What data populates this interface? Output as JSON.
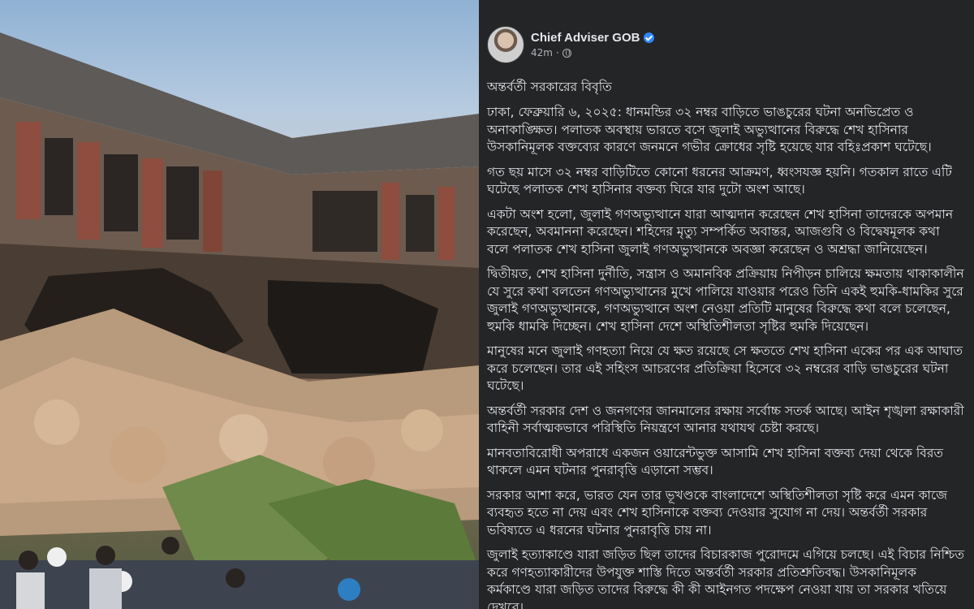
{
  "post": {
    "author": "Chief Adviser GOB",
    "time": "42m",
    "separator": "·",
    "title": "অন্তর্বর্তী সরকারের বিবৃতি",
    "paragraphs": [
      "ঢাকা, ফেব্রুয়ারি ৬, ২০২৫: ধানমন্ডির ৩২ নম্বর বাড়িতে ভাঙচুরের ঘটনা অনভিপ্রেত ও অনাকাঙ্ক্ষিত। পলাতক অবস্থায় ভারতে বসে জুলাই অভ্যুত্থানের বিরুদ্ধে শেখ হাসিনার উসকানিমূলক বক্তব্যের কারণে জনমনে গভীর ক্রোধের সৃষ্টি হয়েছে যার বহিঃপ্রকাশ ঘটেছে।",
      "গত ছয় মাসে ৩২ নম্বর বাড়িটিতে কোনো ধরনের আক্রমণ, ধ্বংসযজ্ঞ হয়নি। গতকাল রাতে এটি ঘটেছে পলাতক শেখ হাসিনার বক্তব্য ঘিরে যার দুটো অংশ আছে।",
      "একটা অংশ হলো, জুলাই গণঅভ্যুত্থানে যারা আত্মদান করেছেন শেখ হাসিনা তাদেরকে অপমান করেছেন, অবমাননা করেছেন। শহিদের মৃত্যু সম্পর্কিত অবান্তর, আজগুবি ও বিদ্বেষমূলক কথা বলে পলাতক শেখ হাসিনা জুলাই গণঅভ্যুত্থানকে অবজ্ঞা করেছেন ও অশ্রদ্ধা জানিয়েছেন।",
      "দ্বিতীয়ত, শেখ হাসিনা দুর্নীতি, সন্ত্রাস ও অমানবিক প্রক্রিয়ায় নিপীড়ন চালিয়ে ক্ষমতায় থাকাকালীন যে সুরে কথা বলতেন গণঅভ্যুত্থানের মুখে পালিয়ে যাওয়ার পরেও তিনি একই হুমকি-ধামকির সুরে জুলাই গণঅভ্যুত্থানকে, গণঅভ্যুত্থানে অংশ নেওয়া প্রতিটি মানুষের বিরুদ্ধে কথা বলে চলেছেন, হুমকি ধামকি দিচ্ছেন। শেখ হাসিনা দেশে অস্থিতিশীলতা সৃষ্টির হুমকি দিয়েছেন।",
      "মানুষের মনে জুলাই গণহত্যা নিয়ে যে ক্ষত রয়েছে সে ক্ষততে শেখ হাসিনা একের পর এক আঘাত করে চলেছেন। তার এই সহিংস আচরণের প্রতিক্রিয়া হিসেবে ৩২ নম্বরের বাড়ি ভাঙচুরের ঘটনা ঘটেছে।",
      "অন্তর্বর্তী সরকার দেশ ও জনগণের জানমালের রক্ষায় সর্বোচ্চ সতর্ক আছে। আইন শৃঙ্খলা রক্ষাকারী বাহিনী সর্বাত্মকভাবে পরিস্থিতি নিয়ন্ত্রণে আনার যথাযথ চেষ্টা করছে।",
      "মানবতাবিরোধী অপরাধে একজন ওয়ারেন্টভুক্ত আসামি শেখ হাসিনা বক্তব্য দেয়া থেকে বিরত থাকলে এমন ঘটনার পুনরাবৃত্তি এড়ানো সম্ভব।",
      "সরকার আশা করে, ভারত যেন তার ভূখণ্ডকে বাংলাদেশে অস্থিতিশীলতা সৃষ্টি করে এমন কাজে ব্যবহৃত হতে না দেয় এবং শেখ হাসিনাকে বক্তব্য দেওয়ার সুযোগ না দেয়। অন্তর্বর্তী সরকার ভবিষ্যতে এ ধরনের ঘটনার পুনরাবৃত্তি চায় না।",
      "জুলাই হত্যাকাণ্ডে যারা জড়িত ছিল তাদের বিচারকাজ পুরোদমে এগিয়ে চলছে। এই বিচার নিশ্চিত করে গণহত্যাকারীদের উপযুক্ত শাস্তি দিতে অন্তর্বর্তী সরকার প্রতিশ্রুতিবদ্ধ। উসকানিমূলক কর্মকাণ্ডে যারা জড়িত তাদের বিরুদ্ধে কী কী আইনগত পদক্ষেপ নেওয়া যায় তা সরকার খতিয়ে দেখবে।"
    ]
  },
  "icons": {
    "verified": "verified-badge-icon",
    "privacy": "globe-icon"
  },
  "colors": {
    "post_background": "#242526",
    "text": "#e4e6eb",
    "verified": "#2d88ff"
  }
}
